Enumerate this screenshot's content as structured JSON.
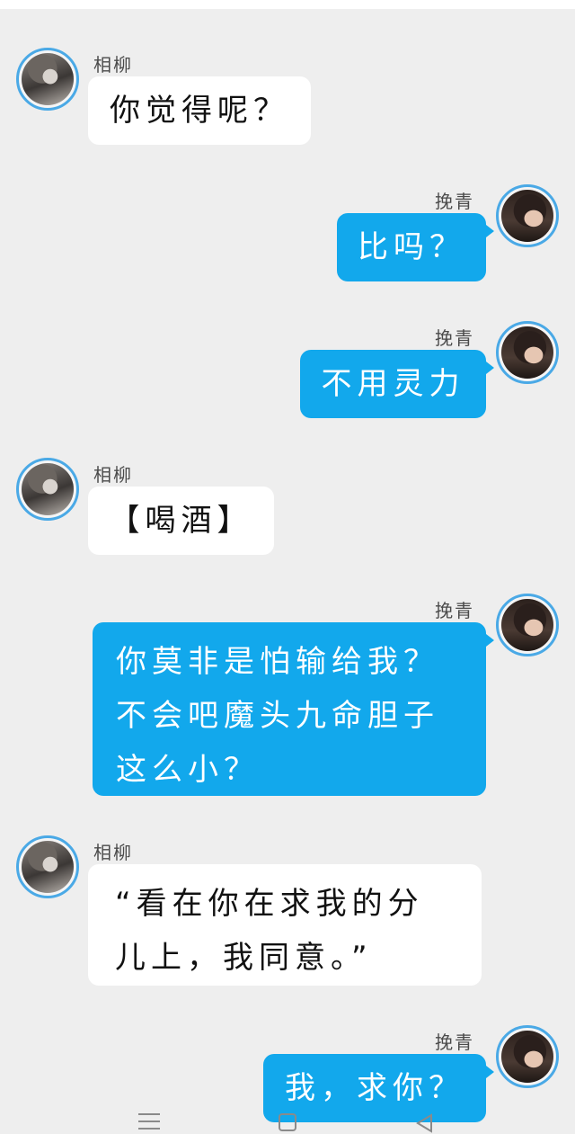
{
  "contacts": {
    "xiangliu": {
      "name": "相柳"
    },
    "wanqing": {
      "name": "挽青"
    }
  },
  "messages": [
    {
      "sender": "相柳",
      "side": "left",
      "lines": [
        "你觉得呢？"
      ]
    },
    {
      "sender": "挽青",
      "side": "right",
      "lines": [
        "比吗？"
      ]
    },
    {
      "sender": "挽青",
      "side": "right",
      "lines": [
        "不用灵力"
      ]
    },
    {
      "sender": "相柳",
      "side": "left",
      "lines": [
        "【喝酒】"
      ]
    },
    {
      "sender": "挽青",
      "side": "right",
      "lines": [
        "你莫非是怕输给我？",
        "不会吧魔头九命胆子",
        "这么小？"
      ]
    },
    {
      "sender": "相柳",
      "side": "left",
      "lines": [
        "“看在你在求我的分",
        "儿上，我同意。”"
      ]
    },
    {
      "sender": "挽青",
      "side": "right",
      "lines": [
        "我，求你？"
      ]
    }
  ],
  "colors": {
    "background": "#eeeeee",
    "bubble_left": "#ffffff",
    "bubble_right": "#12a8ec",
    "avatar_ring": "#4aa9e6"
  },
  "navbar": {
    "icons": [
      "menu-icon",
      "home-icon",
      "back-icon"
    ]
  }
}
